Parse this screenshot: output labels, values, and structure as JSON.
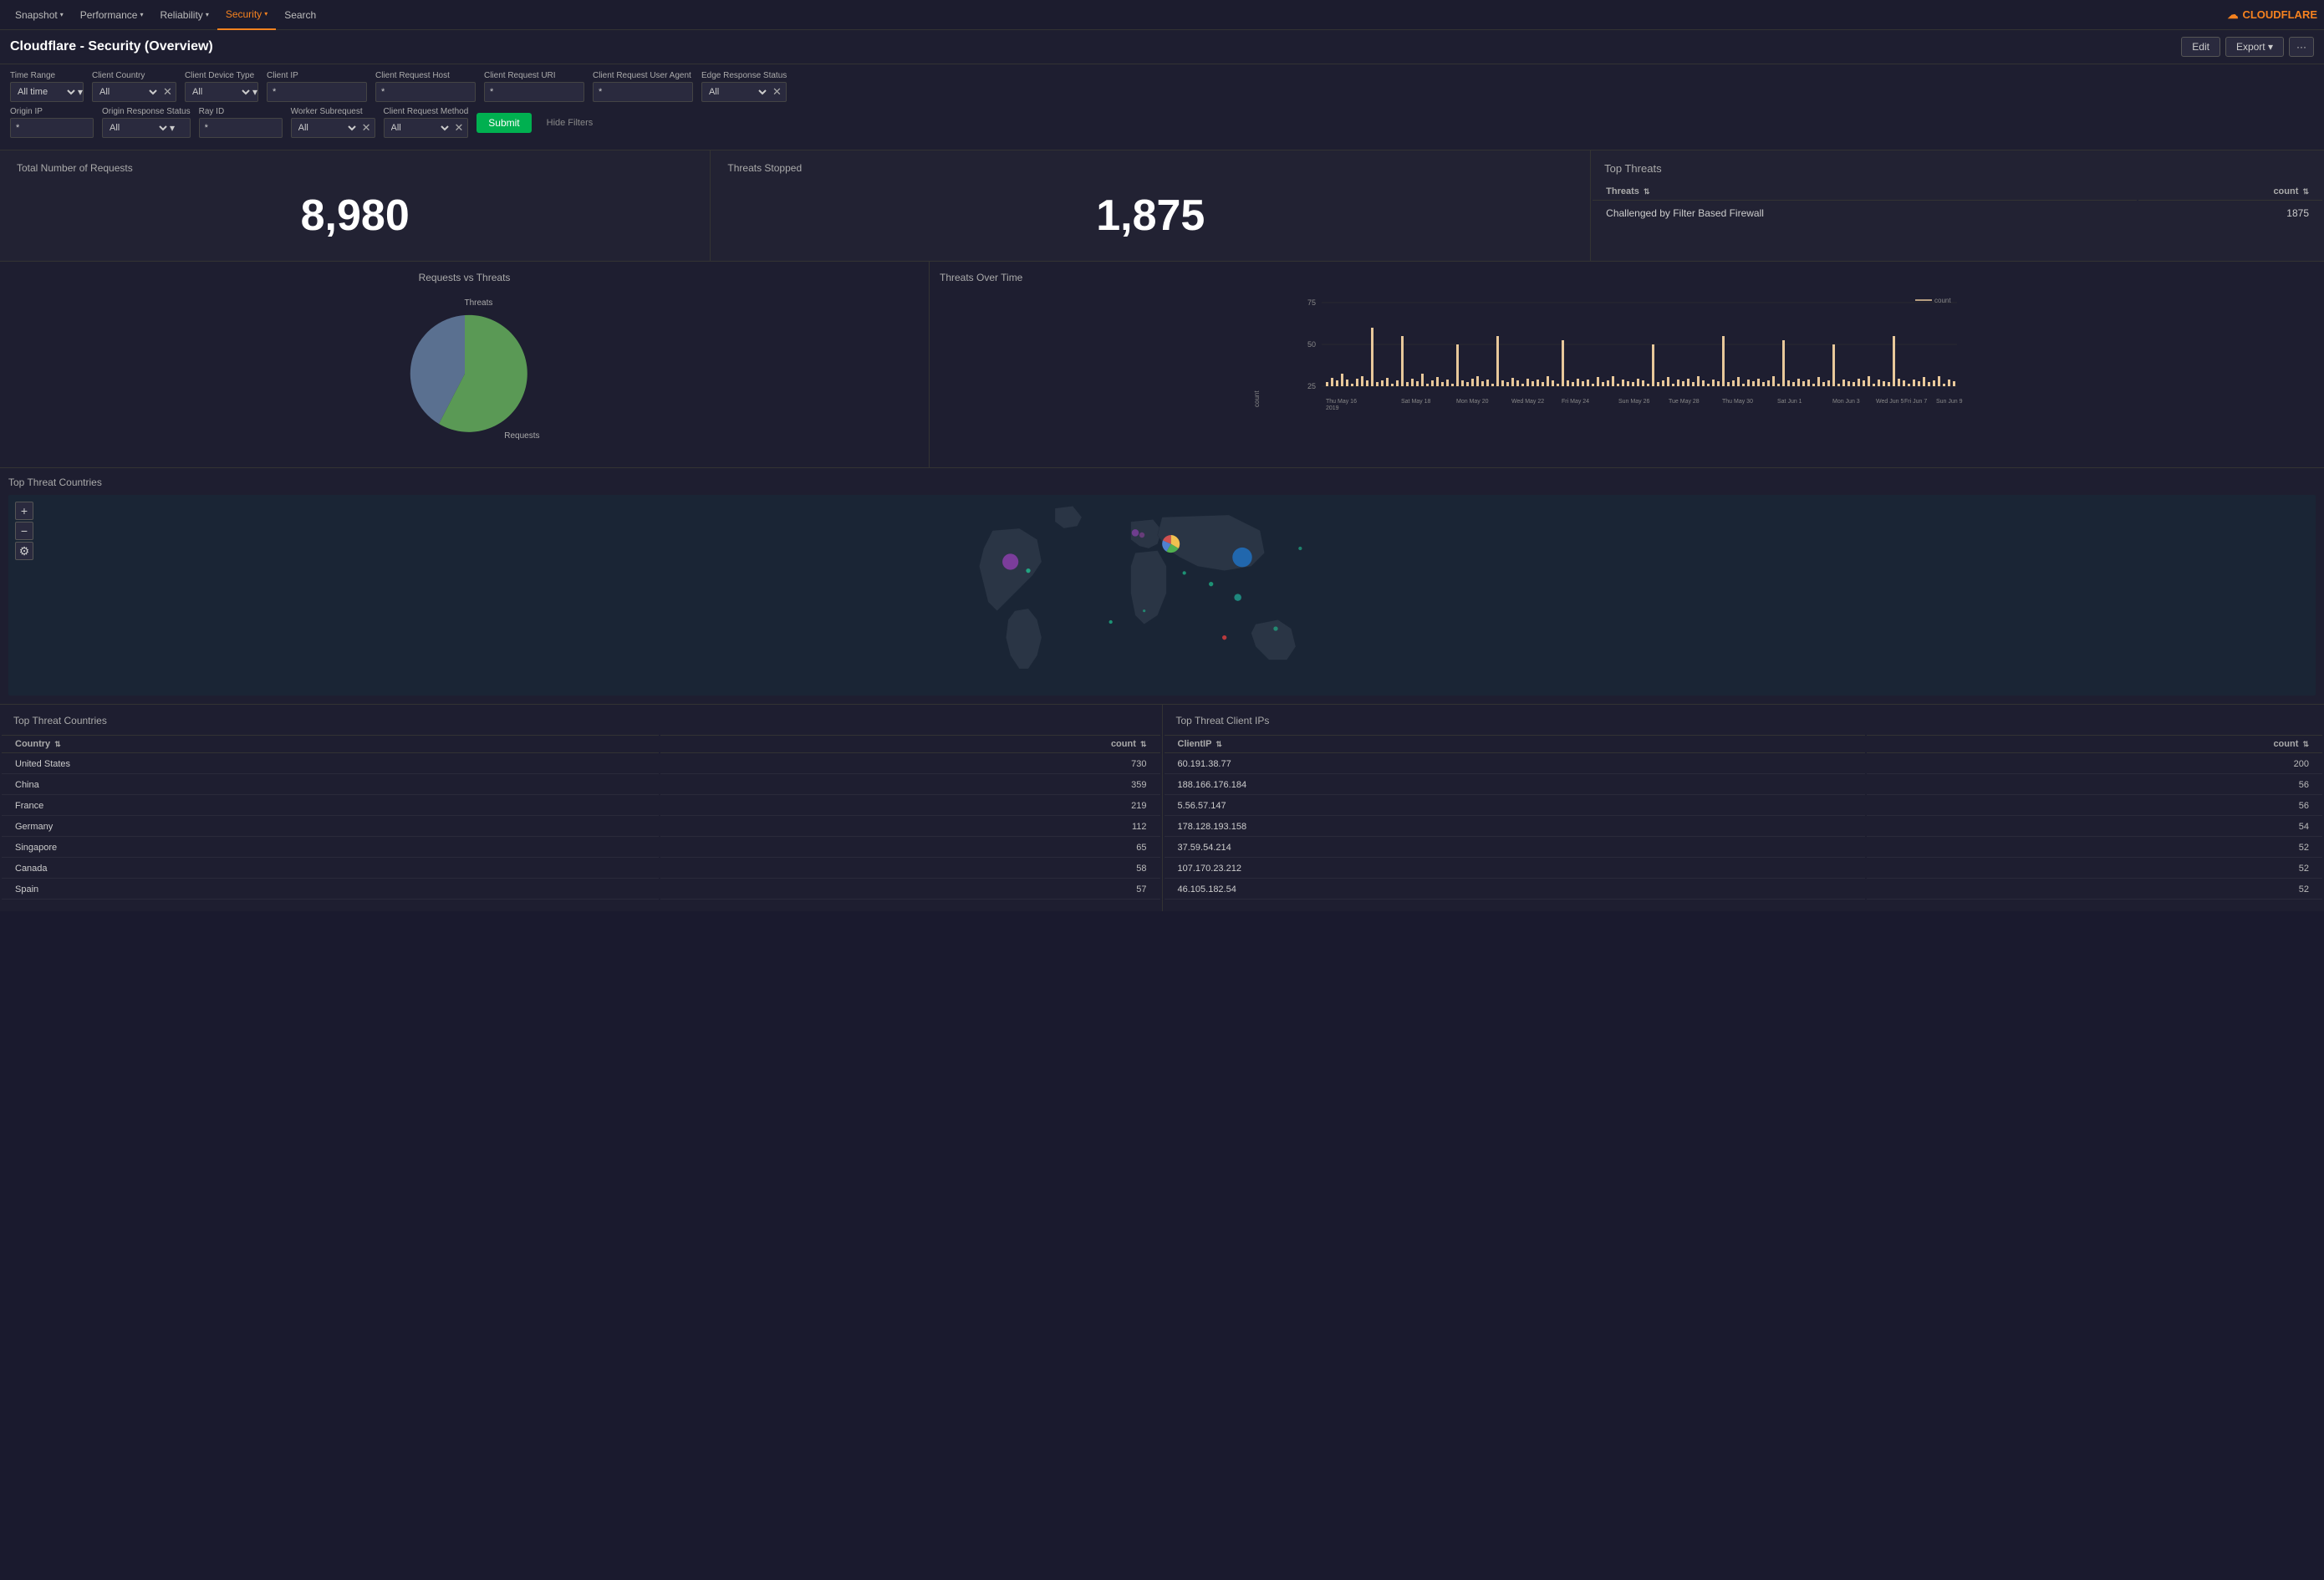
{
  "nav": {
    "items": [
      {
        "label": "Snapshot",
        "arrow": "▾",
        "active": false
      },
      {
        "label": "Performance",
        "arrow": "▾",
        "active": false
      },
      {
        "label": "Reliability",
        "arrow": "▾",
        "active": false
      },
      {
        "label": "Security",
        "arrow": "▾",
        "active": true
      },
      {
        "label": "Search",
        "arrow": "",
        "active": false
      }
    ],
    "logo": "CLOUDFLARE"
  },
  "header": {
    "title": "Cloudflare - Security (Overview)",
    "edit_label": "Edit",
    "export_label": "Export ▾",
    "more_label": "···"
  },
  "filters": {
    "time_range_label": "Time Range",
    "time_range_value": "All time",
    "client_country_label": "Client Country",
    "client_country_value": "All",
    "client_device_label": "Client Device Type",
    "client_device_value": "All",
    "client_ip_label": "Client IP",
    "client_ip_value": "*",
    "client_request_host_label": "Client Request Host",
    "client_request_host_value": "*",
    "client_request_uri_label": "Client Request URI",
    "client_request_uri_value": "*",
    "client_request_user_agent_label": "Client Request User Agent",
    "client_request_user_agent_value": "*",
    "edge_response_status_label": "Edge Response Status",
    "edge_response_status_value": "All",
    "origin_ip_label": "Origin IP",
    "origin_ip_value": "*",
    "origin_response_status_label": "Origin Response Status",
    "origin_response_status_value": "All",
    "ray_id_label": "Ray ID",
    "ray_id_value": "*",
    "worker_subrequest_label": "Worker Subrequest",
    "worker_subrequest_value": "All",
    "client_request_method_label": "Client Request Method",
    "client_request_method_value": "All",
    "submit_label": "Submit",
    "hide_filters_label": "Hide Filters"
  },
  "metrics": {
    "total_requests_title": "Total Number of Requests",
    "total_requests_value": "8,980",
    "threats_stopped_title": "Threats Stopped",
    "threats_stopped_value": "1,875",
    "top_threats_title": "Top Threats",
    "threats_col": "Threats",
    "count_col": "count",
    "top_threats_rows": [
      {
        "threat": "Challenged by Filter Based Firewall",
        "count": "1875"
      }
    ]
  },
  "charts": {
    "requests_vs_threats_title": "Requests vs Threats",
    "threats_over_time_title": "Threats Over Time",
    "pie_label_threats": "Threats",
    "pie_label_requests": "Requests",
    "y_axis_label": "count",
    "chart_legend_label": "count",
    "x_axis_labels": [
      "Thu May 16 2019",
      "Sat May 18",
      "Mon May 20",
      "Wed May 22",
      "Fri May 24",
      "Sun May 26",
      "Tue May 28",
      "Thu May 30",
      "Sat Jun 1",
      "Mon Jun 3",
      "Wed Jun 5",
      "Fri Jun 7",
      "Sun Jun 9"
    ],
    "y_axis_values": [
      "75",
      "50",
      "25"
    ]
  },
  "map": {
    "title": "Top Threat Countries",
    "zoom_in": "+",
    "zoom_out": "−",
    "settings": "⚙"
  },
  "bottom_tables": {
    "countries_title": "Top Threat Countries",
    "country_col": "Country",
    "countries_count_col": "count",
    "countries_rows": [
      {
        "country": "United States",
        "count": "730"
      },
      {
        "country": "China",
        "count": "359"
      },
      {
        "country": "France",
        "count": "219"
      },
      {
        "country": "Germany",
        "count": "112"
      },
      {
        "country": "Singapore",
        "count": "65"
      },
      {
        "country": "Canada",
        "count": "58"
      },
      {
        "country": "Spain",
        "count": "57"
      }
    ],
    "client_ips_title": "Top Threat Client IPs",
    "client_ip_col": "ClientIP",
    "client_ips_count_col": "count",
    "client_ips_rows": [
      {
        "ip": "60.191.38.77",
        "count": "200"
      },
      {
        "ip": "188.166.176.184",
        "count": "56"
      },
      {
        "ip": "5.56.57.147",
        "count": "56"
      },
      {
        "ip": "178.128.193.158",
        "count": "54"
      },
      {
        "ip": "37.59.54.214",
        "count": "52"
      },
      {
        "ip": "107.170.23.212",
        "count": "52"
      },
      {
        "ip": "46.105.182.54",
        "count": "52"
      }
    ]
  }
}
